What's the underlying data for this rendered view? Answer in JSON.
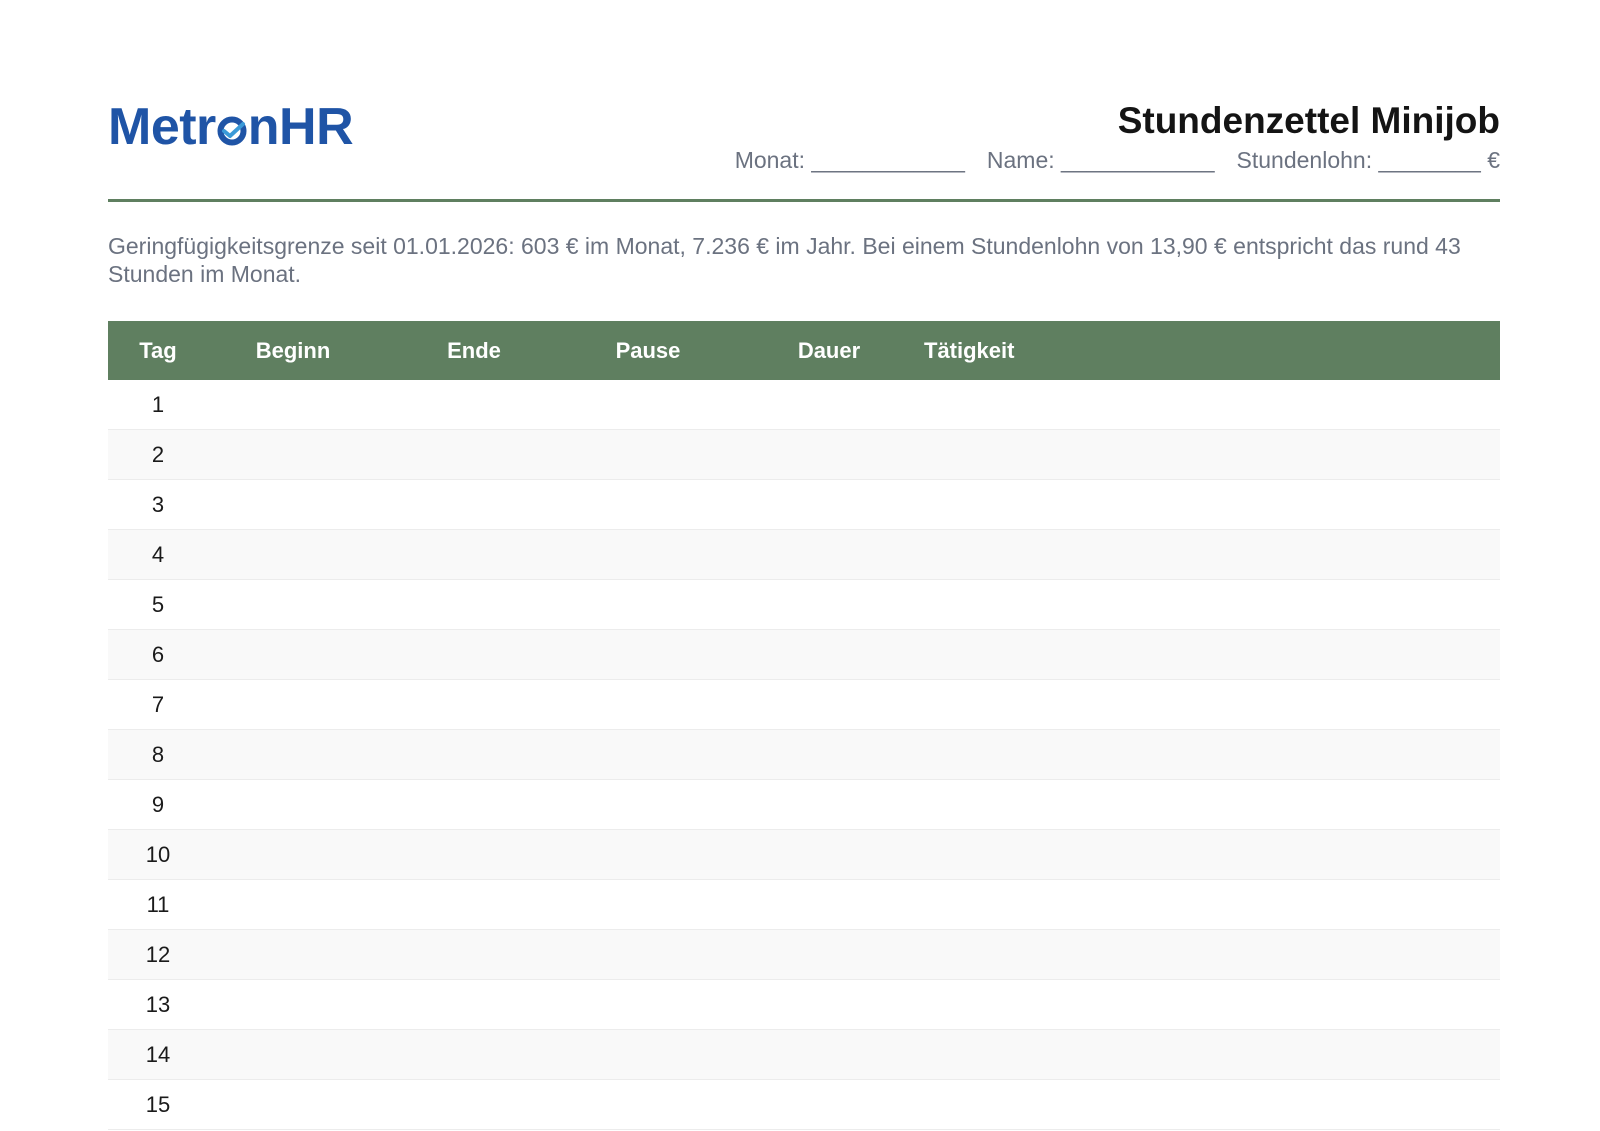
{
  "logo": {
    "text_before": "Metr",
    "text_after": "nHR",
    "brand_color": "#1f54a6",
    "icon": "check-o-icon"
  },
  "title": "Stundenzettel Minijob",
  "meta": {
    "monat": "Monat: ____________",
    "name": "Name: ____________",
    "stundenlohn": "Stundenlohn: ________ €"
  },
  "notice": "Geringfügigkeitsgrenze seit 01.01.2026: 603 € im Monat, 7.236 € im Jahr. Bei einem Stundenlohn von 13,90 € entspricht das rund 43 Stunden im Monat.",
  "colors": {
    "accent_green": "#5f7f60",
    "muted_text": "#6b7280"
  },
  "table": {
    "headers": {
      "tag": "Tag",
      "beginn": "Beginn",
      "ende": "Ende",
      "pause": "Pause",
      "dauer": "Dauer",
      "taetigkeit": "Tätigkeit"
    },
    "rows": [
      "1",
      "2",
      "3",
      "4",
      "5",
      "6",
      "7",
      "8",
      "9",
      "10",
      "11",
      "12",
      "13",
      "14",
      "15"
    ]
  }
}
